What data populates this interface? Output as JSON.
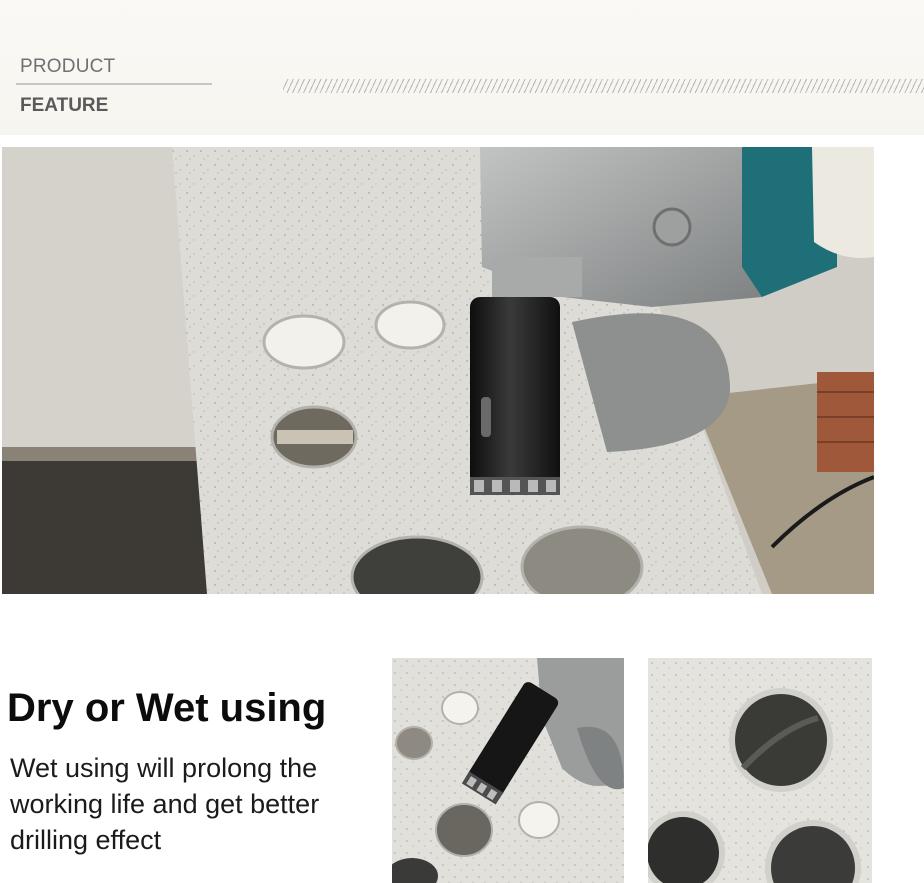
{
  "header": {
    "product_label": "PRODUCT",
    "feature_label": "FEATURE"
  },
  "feature": {
    "heading": "Dry or Wet using",
    "description": "Wet using will prolong the working life and get better drilling effect"
  },
  "colors": {
    "slab": "#dcdbd6",
    "bit": "#1c1c1c",
    "grinder": "#9a9c9c",
    "accent_teal": "#1f6f78"
  }
}
